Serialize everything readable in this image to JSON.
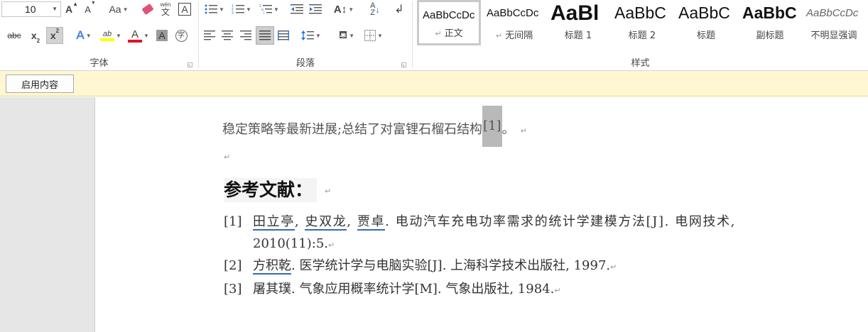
{
  "ribbon": {
    "font": {
      "size_value": "10",
      "label": "字体",
      "grow_font": "A",
      "shrink_font": "A",
      "change_case": "Aa",
      "phonetic_top": "wén",
      "phonetic_bottom": "文",
      "char_border": "A",
      "strikethrough": "abc",
      "subscript": "x",
      "subscript_mark": "2",
      "superscript": "x",
      "superscript_mark": "2",
      "text_effects": "A",
      "highlight": "ab",
      "font_color": "A",
      "char_shading": "A",
      "enclose_char": "字"
    },
    "paragraph": {
      "label": "段落"
    },
    "styles": {
      "label": "样式",
      "items": [
        {
          "sample": "AaBbCcDc",
          "name": "正文",
          "selected": true
        },
        {
          "sample": "AaBbCcDc",
          "name": "无间隔"
        },
        {
          "sample": "AaBl",
          "name": "标题 1"
        },
        {
          "sample": "AaBbC",
          "name": "标题 2"
        },
        {
          "sample": "AaBbC",
          "name": "标题"
        },
        {
          "sample": "AaBbC",
          "name": "副标题"
        },
        {
          "sample": "AaBbCcDc",
          "name": "不明显强调"
        }
      ]
    }
  },
  "message_bar": {
    "enable_label": "启用内容"
  },
  "document": {
    "line1_text": "稳定策略等最新进展;总结了对富锂石榴石结构",
    "line1_citation": "[1]",
    "line1_end": "。",
    "para_mark": "↵",
    "heading": "参考文献：",
    "references": [
      {
        "num": "[1]",
        "authors": [
          "田立亭",
          "史双龙",
          "贾卓"
        ],
        "title": ". 电动汽车充电功率需求的统计学建模方法[J]. 电网技术,",
        "cont": "2010(11):5."
      },
      {
        "num": "[2]",
        "authors": [
          "方积乾"
        ],
        "title": ". 医学统计学与电脑实验[J]. 上海科学技术出版社, 1997."
      },
      {
        "num": "[3]",
        "plain": "屠其璞. 气象应用概率统计学[M]. 气象出版社, 1984."
      }
    ]
  },
  "colors": {
    "highlight_yellow": "#ffff00",
    "font_red": "#e81123",
    "message_bar_bg": "#fff7d1",
    "author_underline": "#2f6db6"
  }
}
